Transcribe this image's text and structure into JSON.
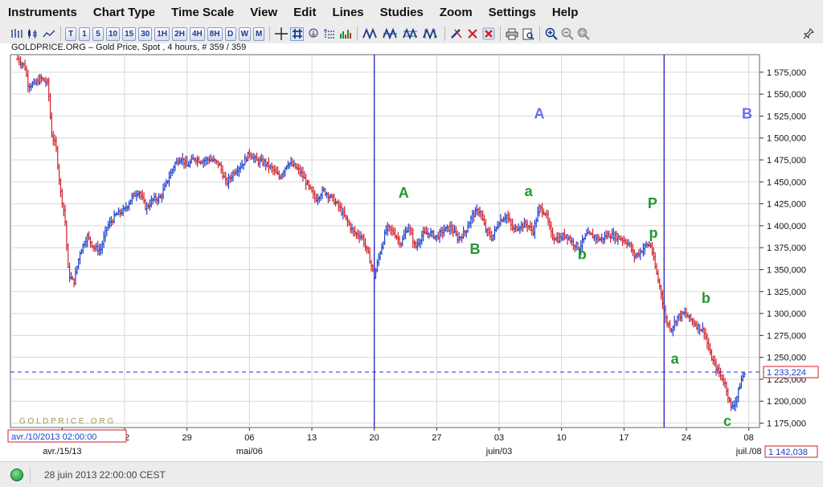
{
  "menu": [
    "Instruments",
    "Chart Type",
    "Time Scale",
    "View",
    "Edit",
    "Lines",
    "Studies",
    "Zoom",
    "Settings",
    "Help"
  ],
  "toolbar": {
    "interval_buttons": [
      "T",
      "1",
      "5",
      "10",
      "15",
      "30",
      "1H",
      "2H",
      "4H",
      "8H",
      "D",
      "W",
      "M"
    ],
    "icons": [
      "bar-chart-icon",
      "candle-chart-icon",
      "line-chart-icon",
      "crosshair-icon",
      "grid-icon",
      "info-cursor-icon",
      "data-cursor-icon",
      "volume-icon",
      "line-draw-icon-1",
      "line-draw-icon-2",
      "line-draw-icon-3",
      "line-draw-icon-4",
      "pencil-delete-icon",
      "delete-icon",
      "delete-all-icon",
      "print-icon",
      "print-preview-icon",
      "zoom-in-icon",
      "zoom-out-icon",
      "zoom-reset-icon",
      "pin-icon"
    ]
  },
  "chart": {
    "title": "GOLDPRICE.ORG – Gold Price, Spot , 4 hours, # 359 / 359",
    "watermark": "G O L D P R I C E . O R G",
    "cursor_time_label": "avr./10/2013 02:00:00",
    "cursor_price_label": "1 142,038",
    "current_price_label": "1 233,224",
    "colors": {
      "up": "#1a3fd0",
      "down": "#d0202a",
      "grid": "#d8d8d8",
      "vline": "#2020c0",
      "hline": "#2030d0",
      "wave_green": "#1f9a2e",
      "wave_blue": "#6a6af0"
    }
  },
  "chart_data": {
    "type": "ohlc",
    "title": "GOLDPRICE.ORG – Gold Price, Spot , 4 hours, # 359 / 359",
    "y_ticks": [
      "1 575,000",
      "1 550,000",
      "1 525,000",
      "1 500,000",
      "1 475,000",
      "1 450,000",
      "1 425,000",
      "1 400,000",
      "1 375,000",
      "1 350,000",
      "1 325,000",
      "1 300,000",
      "1 275,000",
      "1 250,000",
      "1 225,000",
      "1 200,000",
      "1 175,000"
    ],
    "y_tick_values": [
      1575,
      1550,
      1525,
      1500,
      1475,
      1450,
      1425,
      1400,
      1375,
      1350,
      1325,
      1300,
      1275,
      1250,
      1225,
      1200,
      1175
    ],
    "x_ticks": [
      "avr./15/13",
      "22",
      "29",
      "mai/06",
      "13",
      "20",
      "27",
      "juin/03",
      "10",
      "17",
      "24",
      "juil./08"
    ],
    "x_tick_lines": [
      "22",
      "29",
      "06",
      "13",
      "20",
      "27",
      "03",
      "10",
      "17",
      "24",
      "08"
    ],
    "x_tick_days": [
      5,
      12,
      19,
      26,
      33,
      40,
      47,
      54,
      61,
      68,
      75,
      82
    ],
    "ylim": [
      1170,
      1595
    ],
    "xlim": [
      -0.8,
      83.2
    ],
    "current_price": 1233.224,
    "vertical_lines_day": [
      40,
      72.5
    ],
    "wave_labels": [
      {
        "text": "A",
        "day": 43.3,
        "price": 1432,
        "color": "wave_green"
      },
      {
        "text": "B",
        "day": 51.3,
        "price": 1368,
        "color": "wave_green"
      },
      {
        "text": "a",
        "day": 57.3,
        "price": 1434,
        "color": "wave_green"
      },
      {
        "text": "b",
        "day": 63.3,
        "price": 1362,
        "color": "wave_green"
      },
      {
        "text": "P",
        "day": 71.2,
        "price": 1420,
        "color": "wave_green"
      },
      {
        "text": "p",
        "day": 71.3,
        "price": 1386,
        "color": "wave_green"
      },
      {
        "text": "a",
        "day": 73.7,
        "price": 1243,
        "color": "wave_green"
      },
      {
        "text": "b",
        "day": 77.2,
        "price": 1312,
        "color": "wave_green"
      },
      {
        "text": "c",
        "day": 79.6,
        "price": 1172,
        "color": "wave_green"
      },
      {
        "text": "A",
        "day": 58.5,
        "price": 1522,
        "color": "wave_blue"
      },
      {
        "text": "B",
        "day": 81.8,
        "price": 1522,
        "color": "wave_blue"
      }
    ],
    "price_path": [
      [
        0,
        1590
      ],
      [
        0.8,
        1582
      ],
      [
        1.2,
        1560
      ],
      [
        2,
        1562
      ],
      [
        2.6,
        1568
      ],
      [
        3.4,
        1562
      ],
      [
        3.8,
        1505
      ],
      [
        4.3,
        1490
      ],
      [
        4.8,
        1440
      ],
      [
        5.3,
        1410
      ],
      [
        5.7,
        1345
      ],
      [
        6.3,
        1335
      ],
      [
        7,
        1370
      ],
      [
        7.8,
        1388
      ],
      [
        8.6,
        1375
      ],
      [
        9.3,
        1372
      ],
      [
        10,
        1398
      ],
      [
        11,
        1412
      ],
      [
        12,
        1418
      ],
      [
        12.8,
        1432
      ],
      [
        13.6,
        1440
      ],
      [
        14.4,
        1420
      ],
      [
        15.2,
        1430
      ],
      [
        16,
        1432
      ],
      [
        17,
        1456
      ],
      [
        17.6,
        1470
      ],
      [
        18.3,
        1478
      ],
      [
        19,
        1468
      ],
      [
        19.8,
        1477
      ],
      [
        20.6,
        1474
      ],
      [
        21.6,
        1476
      ],
      [
        22.6,
        1470
      ],
      [
        23.4,
        1448
      ],
      [
        24.3,
        1462
      ],
      [
        25.2,
        1470
      ],
      [
        26,
        1483
      ],
      [
        26.8,
        1474
      ],
      [
        27.7,
        1472
      ],
      [
        28.5,
        1465
      ],
      [
        29.4,
        1455
      ],
      [
        30.3,
        1472
      ],
      [
        31,
        1468
      ],
      [
        31.8,
        1460
      ],
      [
        32.6,
        1445
      ],
      [
        33.4,
        1430
      ],
      [
        34.3,
        1440
      ],
      [
        35.2,
        1432
      ],
      [
        36,
        1422
      ],
      [
        36.8,
        1408
      ],
      [
        37.7,
        1392
      ],
      [
        38.6,
        1388
      ],
      [
        39.4,
        1365
      ],
      [
        40,
        1342
      ],
      [
        40.6,
        1368
      ],
      [
        41.4,
        1398
      ],
      [
        42.2,
        1392
      ],
      [
        43,
        1380
      ],
      [
        43.8,
        1400
      ],
      [
        44.6,
        1375
      ],
      [
        45.4,
        1390
      ],
      [
        46.2,
        1392
      ],
      [
        47,
        1387
      ],
      [
        47.8,
        1395
      ],
      [
        48.6,
        1398
      ],
      [
        49.4,
        1385
      ],
      [
        50.2,
        1393
      ],
      [
        51,
        1412
      ],
      [
        51.8,
        1418
      ],
      [
        52.5,
        1395
      ],
      [
        53.2,
        1386
      ],
      [
        54,
        1405
      ],
      [
        54.8,
        1412
      ],
      [
        55.6,
        1395
      ],
      [
        56.3,
        1400
      ],
      [
        57.1,
        1402
      ],
      [
        57.8,
        1393
      ],
      [
        58.5,
        1420
      ],
      [
        59.2,
        1415
      ],
      [
        59.9,
        1388
      ],
      [
        60.7,
        1385
      ],
      [
        61.5,
        1390
      ],
      [
        62.3,
        1380
      ],
      [
        63,
        1375
      ],
      [
        63.8,
        1390
      ],
      [
        64.6,
        1388
      ],
      [
        65.4,
        1384
      ],
      [
        66.2,
        1390
      ],
      [
        67,
        1388
      ],
      [
        67.8,
        1385
      ],
      [
        68.5,
        1380
      ],
      [
        69.2,
        1365
      ],
      [
        69.8,
        1370
      ],
      [
        70.5,
        1378
      ],
      [
        71,
        1378
      ],
      [
        71.6,
        1348
      ],
      [
        72.2,
        1322
      ],
      [
        72.7,
        1292
      ],
      [
        73.3,
        1282
      ],
      [
        74,
        1296
      ],
      [
        74.8,
        1300
      ],
      [
        75.6,
        1292
      ],
      [
        76.3,
        1285
      ],
      [
        77,
        1280
      ],
      [
        77.6,
        1255
      ],
      [
        78.2,
        1240
      ],
      [
        78.8,
        1230
      ],
      [
        79.4,
        1218
      ],
      [
        80,
        1192
      ],
      [
        80.6,
        1202
      ],
      [
        81.2,
        1226
      ],
      [
        81.6,
        1233
      ]
    ]
  },
  "status": {
    "datetime": "28 juin 2013 22:00:00 CEST"
  }
}
